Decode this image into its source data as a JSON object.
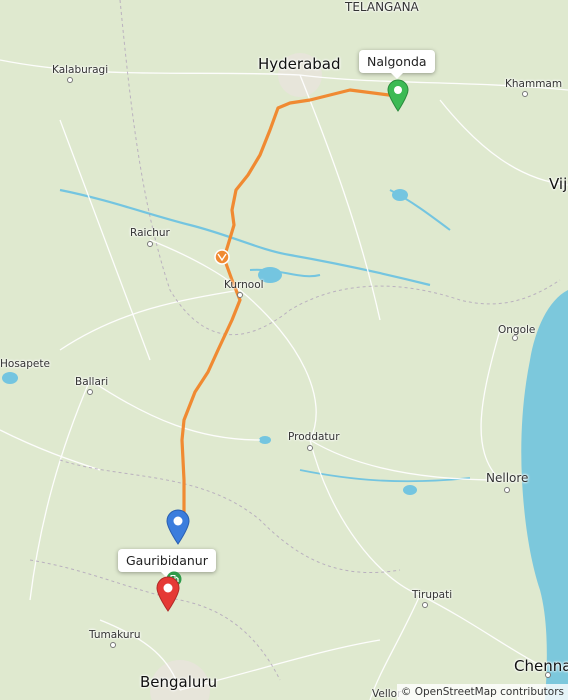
{
  "labels": {
    "telangana": "TELANGANA",
    "hyderabad": "Hyderabad",
    "kalaburagi": "Kalaburagi",
    "khammam": "Khammam",
    "vij": "Vij",
    "raichur": "Raichur",
    "kurnool": "Kurnool",
    "ongole": "Ongole",
    "hosapete": "Hosapete",
    "ballari": "Ballari",
    "proddatur": "Proddatur",
    "nellore": "Nellore",
    "tirupati": "Tirupati",
    "tumakuru": "Tumakuru",
    "bengaluru": "Bengaluru",
    "chennai": "Chenna",
    "vellore": "Vellor"
  },
  "markers": {
    "origin_label": "Nalgonda",
    "destination_label": "Gauribidanur"
  },
  "attribution": "© OpenStreetMap contributors",
  "colors": {
    "route": "#f08a32",
    "origin_pin": "#3cba54",
    "current_pin": "#3b7ddd",
    "poi_pin": "#e53935",
    "sea": "#7cc8dc",
    "land": "#dfe9cf",
    "water": "#74c5e0"
  },
  "icons": {
    "route_waypoint": "toll-icon",
    "poi_badge": "fuel-icon"
  }
}
